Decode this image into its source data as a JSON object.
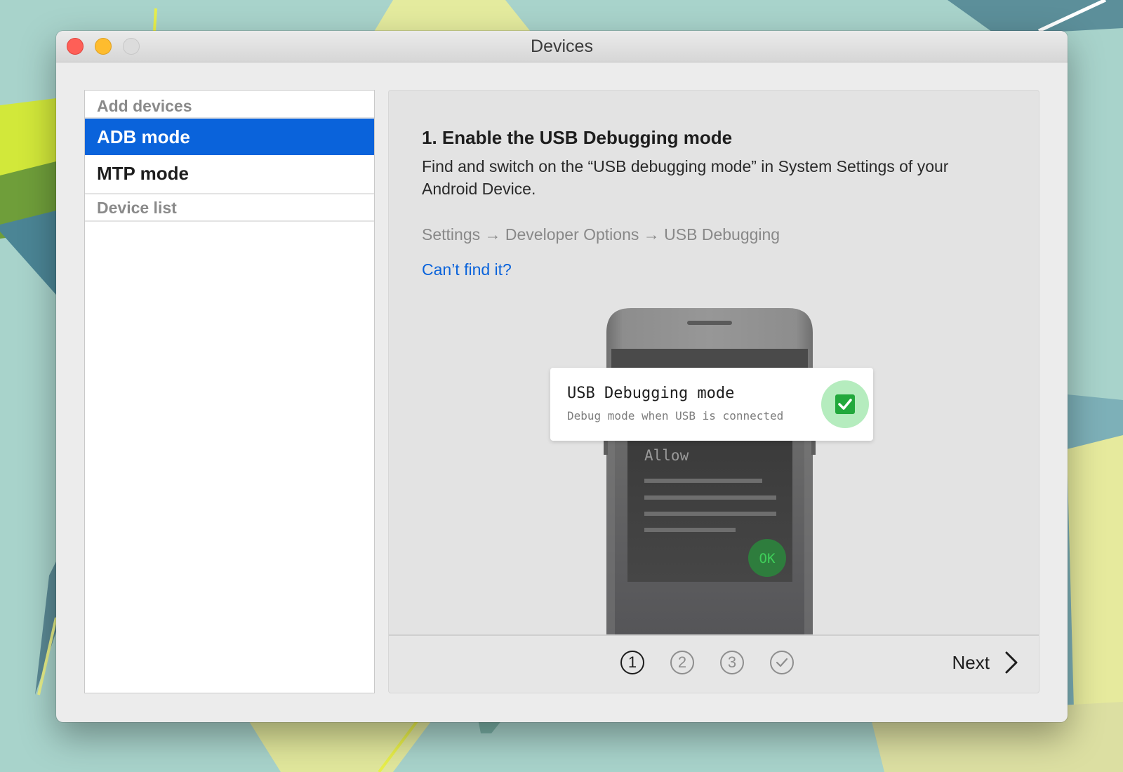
{
  "window": {
    "title": "Devices"
  },
  "sidebar": {
    "sections": [
      {
        "header": "Add devices",
        "items": [
          {
            "label": "ADB mode",
            "selected": true
          },
          {
            "label": "MTP mode",
            "selected": false
          }
        ]
      },
      {
        "header": "Device list",
        "items": []
      }
    ]
  },
  "content": {
    "heading": "1. Enable the USB Debugging mode",
    "description": "Find and switch on the “USB debugging mode” in System Settings of your Android Device.",
    "settings_path": "Settings → Developer Options → USB Debugging",
    "help_link": "Can’t find it?",
    "illustration": {
      "toast_title": "USB Debugging mode",
      "toast_subtitle": "Debug mode when USB is connected",
      "toast_checked": true,
      "dialog_title": "Allow",
      "dialog_button": "OK"
    }
  },
  "footer": {
    "steps": [
      "1",
      "2",
      "3",
      "done"
    ],
    "current_step": 1,
    "next_label": "Next"
  },
  "colors": {
    "accent": "#0a63db",
    "success": "#22a83c"
  }
}
